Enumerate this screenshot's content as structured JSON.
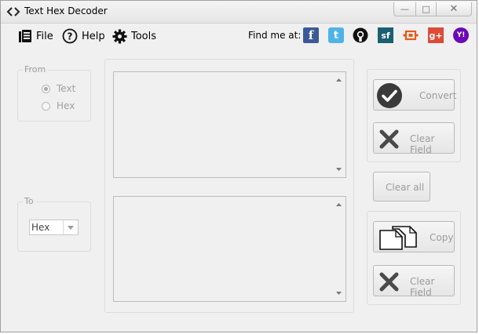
{
  "window": {
    "title": "Text Hex Decoder",
    "controls": {
      "minimize": "—",
      "maximize": "□",
      "close": "✕"
    }
  },
  "menu": {
    "file": "File",
    "help": "Help",
    "tools": "Tools",
    "find_me_at": "Find me at:"
  },
  "social": [
    {
      "name": "facebook",
      "glyph": "f",
      "color": "#3b5998"
    },
    {
      "name": "twitter",
      "glyph": "t",
      "color": "#4fb3e8"
    },
    {
      "name": "github",
      "glyph": "",
      "color": "#111111"
    },
    {
      "name": "sourceforge",
      "glyph": "sf",
      "color": "#1b5f73"
    },
    {
      "name": "ohloh",
      "glyph": "",
      "color": "#e65a1a"
    },
    {
      "name": "google-plus",
      "glyph": "g+",
      "color": "#dd4b39"
    },
    {
      "name": "yahoo",
      "glyph": "Y!",
      "color": "#6b0ab8"
    }
  ],
  "from_group": {
    "legend": "From",
    "options": [
      "Text",
      "Hex"
    ],
    "selected": "Text"
  },
  "to_group": {
    "legend": "To",
    "selected": "Hex"
  },
  "buttons": {
    "convert": "Convert",
    "clear_field_top": "Clear Field",
    "clear_all": "Clear all",
    "copy": "Copy",
    "clear_field_bottom": "Clear Field"
  }
}
